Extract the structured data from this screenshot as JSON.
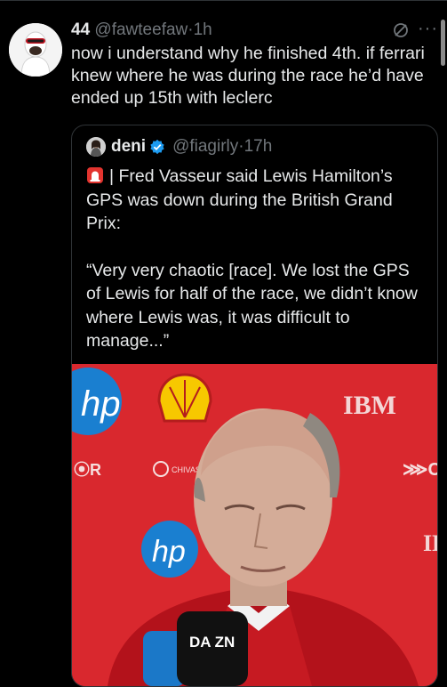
{
  "tweet": {
    "display_name": "44",
    "handle": "@fawteefaw",
    "separator": "·",
    "time": "1h",
    "text": "now i understand why he finished 4th. if ferrari knew where he was during the race he’d have ended up 15th with leclerc",
    "icons": [
      "grok-icon",
      "more-icon"
    ]
  },
  "quoted": {
    "display_name": "deni",
    "handle": "@fiagirly",
    "separator": "·",
    "time": "17h",
    "paragraph1": "| Fred Vasseur said Lewis Hamilton’s GPS was down during the British Grand Prix:",
    "paragraph2": "“Very very chaotic [race]. We lost the GPS of Lewis for half of the race, we didn’t know where Lewis was, it was difficult to manage...”",
    "icons": [
      "siren-icon",
      "verified-icon"
    ]
  },
  "media": {
    "logos": [
      "hp",
      "IBM",
      "CHIVAS REGAL",
      "DAZN"
    ],
    "microphone_label": "DA ZN"
  },
  "colors": {
    "background": "#000000",
    "text": "#e7e9ea",
    "secondary": "#71767b",
    "border": "#2f3336",
    "verified": "#1d9bf0",
    "backdrop": "#d9282e"
  }
}
